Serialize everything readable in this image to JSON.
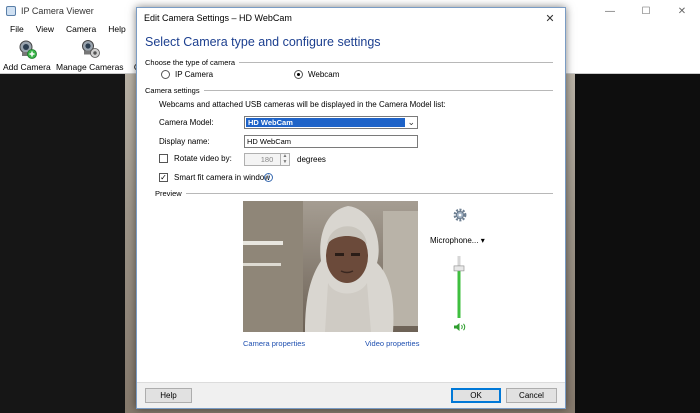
{
  "main_window": {
    "title": "IP Camera Viewer",
    "menu": [
      "File",
      "View",
      "Camera",
      "Help"
    ],
    "toolbar": {
      "add_camera": "Add Camera",
      "manage_cameras": "Manage Cameras",
      "cut_label": "C"
    },
    "window_controls": {
      "minimize": "—",
      "maximize": "☐",
      "close": "✕"
    }
  },
  "dialog": {
    "title": "Edit Camera Settings – HD WebCam",
    "close": "✕",
    "heading": "Select Camera type and configure settings",
    "camera_type": {
      "group_label": "Choose the type of camera",
      "options": [
        {
          "label": "IP Camera",
          "selected": false
        },
        {
          "label": "Webcam",
          "selected": true
        }
      ]
    },
    "camera_settings": {
      "group_label": "Camera settings",
      "description": "Webcams and attached USB cameras will be displayed in the Camera Model list:",
      "model_label": "Camera Model:",
      "model_value": "HD WebCam",
      "display_name_label": "Display name:",
      "display_name_value": "HD WebCam",
      "rotate_label": "Rotate video by:",
      "rotate_checked": false,
      "rotate_value": "180",
      "rotate_unit": "degrees",
      "smart_fit_label": "Smart fit camera in window",
      "smart_fit_checked": true,
      "info_icon": "i"
    },
    "preview": {
      "group_label": "Preview",
      "camera_properties_link": "Camera properties",
      "video_properties_link": "Video properties",
      "microphone_label": "Microphone...",
      "microphone_arrow": "▾",
      "volume_level": 0.8
    },
    "footer": {
      "help": "Help",
      "ok": "OK",
      "cancel": "Cancel"
    }
  }
}
